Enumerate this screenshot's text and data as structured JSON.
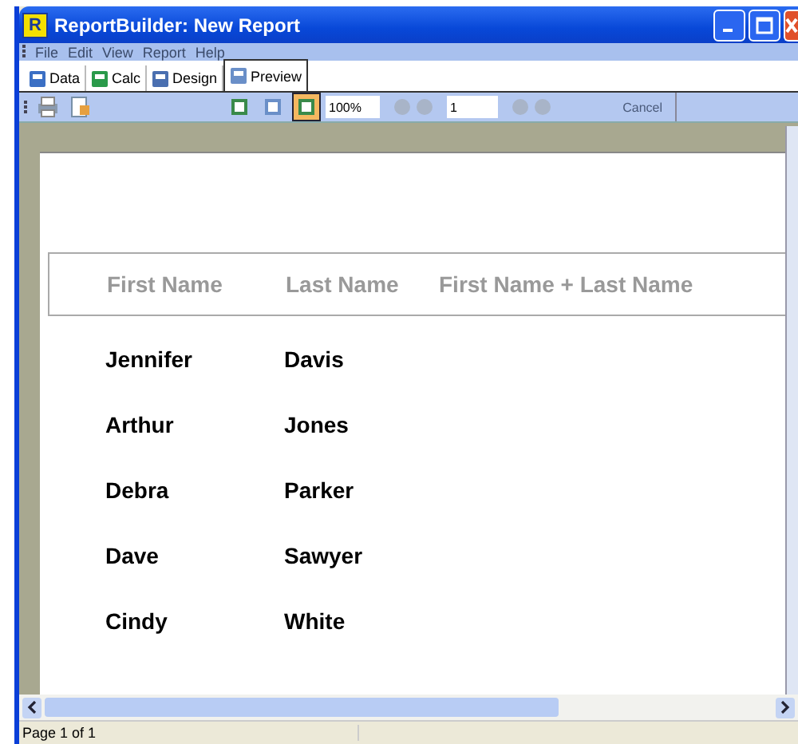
{
  "window": {
    "title": "ReportBuilder: New Report",
    "logo": "R"
  },
  "menu": [
    {
      "label": "File",
      "disabled": true
    },
    {
      "label": "Edit",
      "disabled": true
    },
    {
      "label": "View",
      "disabled": true
    },
    {
      "label": "Report",
      "disabled": true
    },
    {
      "label": "Help",
      "disabled": true
    }
  ],
  "tabs": [
    {
      "label": "Data",
      "kind": "data",
      "selected": false
    },
    {
      "label": "Calc",
      "kind": "calc",
      "selected": false
    },
    {
      "label": "Design",
      "kind": "design",
      "selected": false
    },
    {
      "label": "Preview",
      "kind": "preview",
      "selected": true
    }
  ],
  "toolbar": {
    "zoom": "100%",
    "page": "1",
    "cancel": {
      "label": "Cancel",
      "disabled": true
    },
    "page_buttons": [
      {
        "kind": "whole",
        "selected": false
      },
      {
        "kind": "width",
        "selected": false
      },
      {
        "kind": "percent",
        "selected": true
      }
    ]
  },
  "report": {
    "columns": [
      "First Name",
      "Last Name",
      "First Name + Last Name"
    ],
    "rows": [
      [
        "Jennifer",
        "Davis"
      ],
      [
        "Arthur",
        "Jones"
      ],
      [
        "Debra",
        "Parker"
      ],
      [
        "Dave",
        "Sawyer"
      ],
      [
        "Cindy",
        "White"
      ]
    ]
  },
  "status_bar": "Page 1 of 1"
}
